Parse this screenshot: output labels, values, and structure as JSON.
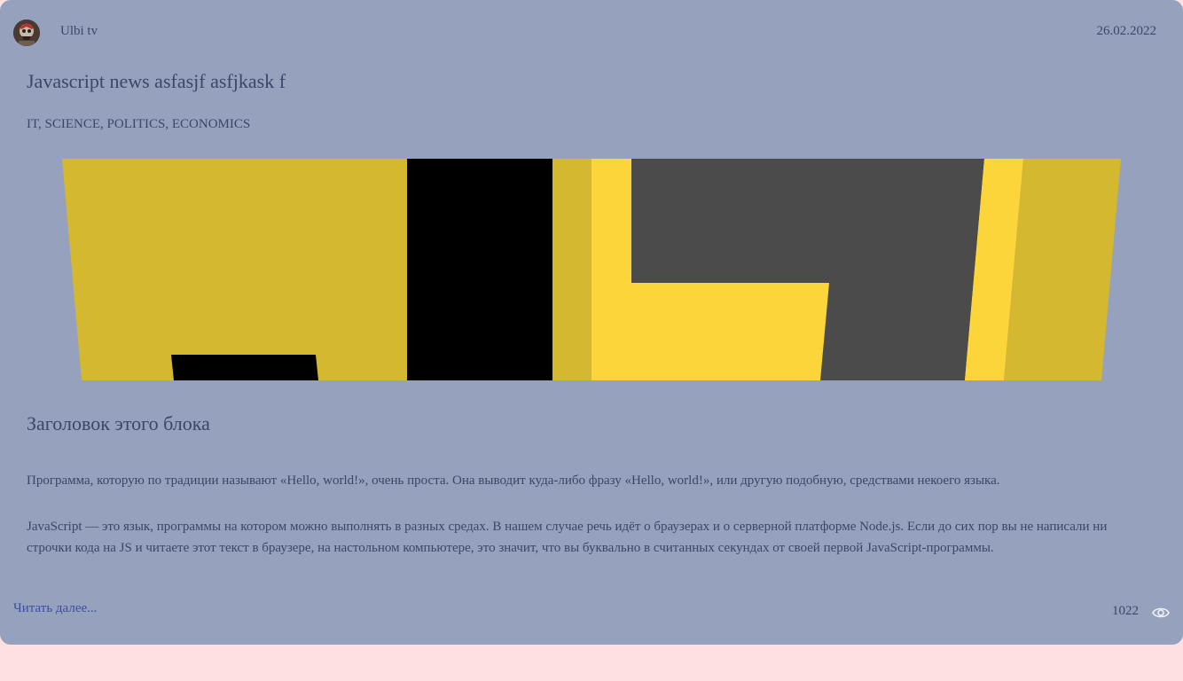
{
  "article": {
    "author": {
      "username": "Ulbi tv",
      "avatar_icon": "avatar-image"
    },
    "created_at": "26.02.2022",
    "title": "Javascript news asfasjf asfjkask f",
    "types": "IT, SCIENCE, POLITICS, ECONOMICS",
    "image_icon": "javascript-logo-image",
    "block": {
      "title": "Заголовок этого блока",
      "paragraphs": [
        "Программа, которую по традиции называют «Hello, world!», очень проста. Она выводит куда-либо фразу «Hello, world!», или другую подобную, средствами некоего языка.",
        "JavaScript — это язык, программы на котором можно выполнять в разных средах. В нашем случае речь идёт о браузерах и о серверной платформе Node.js. Если до сих пор вы не написали ни строчки кода на JS и читаете этот текст в браузере, на настольном компьютере, это значит, что вы буквально в считанных секундах от своей первой JavaScript-программы."
      ]
    },
    "read_more_label": "Читать далее...",
    "views": "1022",
    "views_icon": "eye-icon"
  },
  "colors": {
    "card_background": "#95a1bd",
    "page_background": "#fde0df",
    "text": "#3c4668",
    "link": "#3c4ea0"
  }
}
